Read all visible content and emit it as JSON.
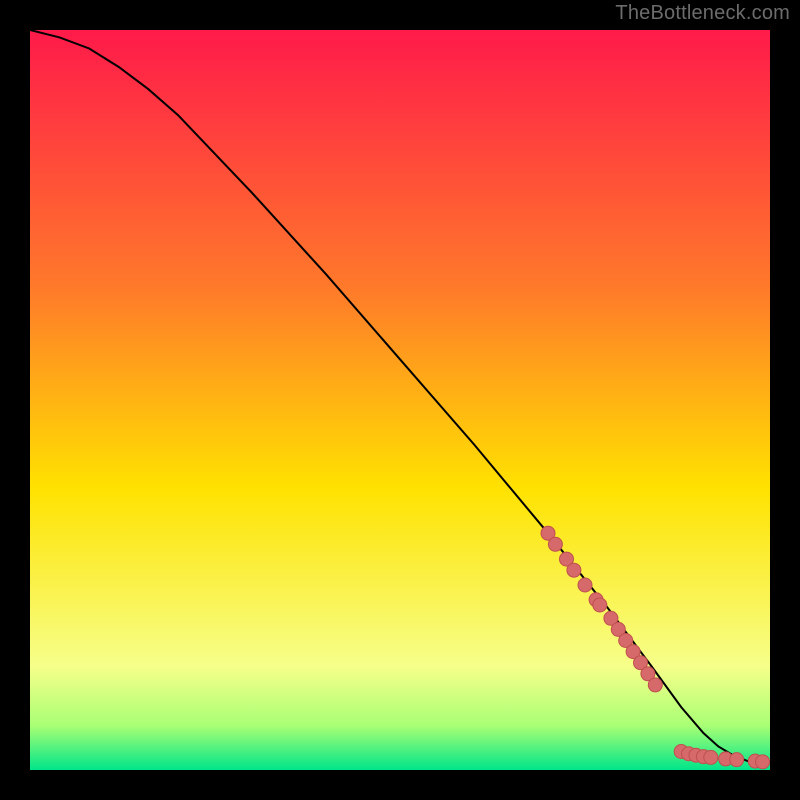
{
  "attribution": "TheBottleneck.com",
  "colors": {
    "background": "#000000",
    "gradient_top": "#ff1a4a",
    "gradient_mid1": "#ff7a2a",
    "gradient_mid2": "#ffe200",
    "gradient_bottom1": "#f6ff8a",
    "gradient_bottom2": "#a9ff74",
    "gradient_bottom3": "#00e58a",
    "curve": "#000000",
    "marker_fill": "#d66a6a",
    "marker_stroke": "#c04f4f"
  },
  "chart_data": {
    "type": "line",
    "title": "",
    "xlabel": "",
    "ylabel": "",
    "xlim": [
      0,
      100
    ],
    "ylim": [
      0,
      100
    ],
    "series": [
      {
        "name": "curve",
        "x": [
          0,
          4,
          8,
          12,
          16,
          20,
          30,
          40,
          50,
          60,
          70,
          78,
          84,
          88,
          91,
          93,
          95,
          97,
          100
        ],
        "y": [
          100,
          99,
          97.5,
          95,
          92,
          88.5,
          78,
          67,
          55.5,
          44,
          32,
          22,
          14,
          8.5,
          5,
          3.2,
          2,
          1.2,
          1
        ]
      }
    ],
    "markers": [
      {
        "x": 70,
        "y": 32
      },
      {
        "x": 71,
        "y": 30.5
      },
      {
        "x": 72.5,
        "y": 28.5
      },
      {
        "x": 73.5,
        "y": 27
      },
      {
        "x": 75,
        "y": 25
      },
      {
        "x": 76.5,
        "y": 23
      },
      {
        "x": 77,
        "y": 22.3
      },
      {
        "x": 78.5,
        "y": 20.5
      },
      {
        "x": 79.5,
        "y": 19
      },
      {
        "x": 80.5,
        "y": 17.5
      },
      {
        "x": 81.5,
        "y": 16
      },
      {
        "x": 82.5,
        "y": 14.5
      },
      {
        "x": 83.5,
        "y": 13
      },
      {
        "x": 84.5,
        "y": 11.5
      },
      {
        "x": 88,
        "y": 2.5
      },
      {
        "x": 89,
        "y": 2.2
      },
      {
        "x": 90,
        "y": 2.0
      },
      {
        "x": 91,
        "y": 1.8
      },
      {
        "x": 92,
        "y": 1.7
      },
      {
        "x": 94,
        "y": 1.5
      },
      {
        "x": 95.5,
        "y": 1.4
      },
      {
        "x": 98,
        "y": 1.2
      },
      {
        "x": 99,
        "y": 1.1
      }
    ]
  }
}
